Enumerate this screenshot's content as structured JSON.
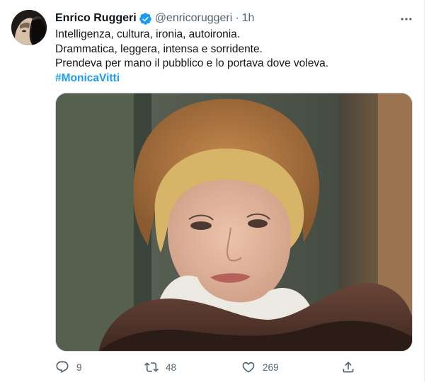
{
  "tweet": {
    "author": {
      "display_name": "Enrico Ruggeri",
      "handle": "@enricoruggeri",
      "verified_icon": "verified-badge-icon"
    },
    "separator": "·",
    "time": "1h",
    "text_lines": [
      "Intelligenza, cultura, ironia, autoironia.",
      "Drammatica, leggera, intensa e sorridente.",
      "Prendeva per mano il pubblico e lo portava dove voleva."
    ],
    "hashtag": "#MonicaVitti",
    "media": {
      "icon": "photo"
    },
    "actions": {
      "reply": {
        "icon": "reply-icon",
        "count": "9"
      },
      "retweet": {
        "icon": "retweet-icon",
        "count": "48"
      },
      "like": {
        "icon": "heart-icon",
        "count": "269"
      },
      "share": {
        "icon": "share-icon"
      }
    },
    "colors": {
      "accent": "#1d9bf0",
      "text": "#0f1419",
      "secondary": "#536471"
    }
  }
}
